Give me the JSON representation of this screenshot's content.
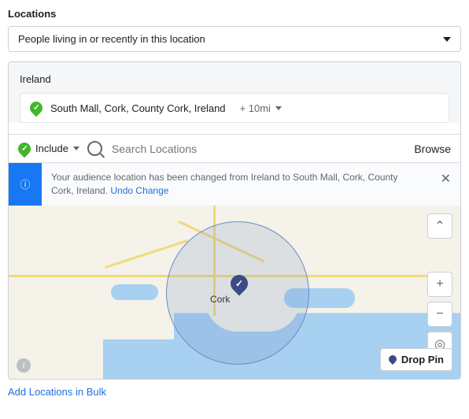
{
  "title": "Locations",
  "dropdown": {
    "value": "People living in or recently in this location"
  },
  "country": "Ireland",
  "selected": {
    "name": "South Mall, Cork, County Cork, Ireland",
    "radius": "+ 10mi"
  },
  "search": {
    "include_label": "Include",
    "placeholder": "Search Locations",
    "browse_label": "Browse"
  },
  "notice": {
    "text": "Your audience location has been changed from Ireland to South Mall, Cork, County Cork, Ireland.",
    "undo": "Undo Change"
  },
  "map": {
    "city_label": "Cork",
    "drop_pin_label": "Drop Pin"
  },
  "bulk_link": "Add Locations in Bulk"
}
